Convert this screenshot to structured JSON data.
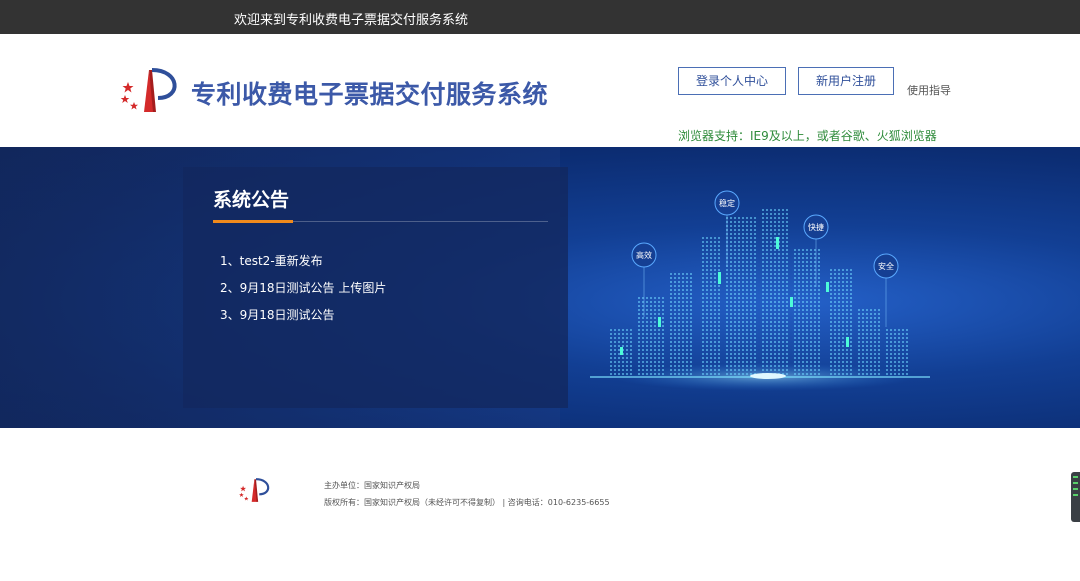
{
  "topbar": {
    "welcome": "欢迎来到专利收费电子票据交付服务系统"
  },
  "header": {
    "title": "专利收费电子票据交付服务系统",
    "login_button": "登录个人中心",
    "register_button": "新用户注册",
    "guide_link": "使用指导",
    "browser_tip": "浏览器支持：IE9及以上，或者谷歌、火狐浏览器"
  },
  "notice": {
    "title": "系统公告",
    "items": [
      "1、test2-重新发布",
      "2、9月18日测试公告 上传图片",
      "3、9月18日测试公告"
    ]
  },
  "banner_tags": {
    "stable": "稳定",
    "fast": "快捷",
    "efficient": "高效",
    "secure": "安全"
  },
  "footer": {
    "host": "主办单位：国家知识产权局",
    "copyright": "版权所有：国家知识产权局（未经许可不得复制）  | 咨询电话：010-6235-6655"
  },
  "colors": {
    "topbar": "#333333",
    "title_blue": "#3c59a8",
    "accent_orange": "#f08a1c",
    "tip_green": "#2e8b3a"
  }
}
